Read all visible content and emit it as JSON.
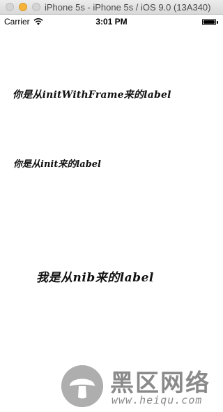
{
  "window": {
    "title": "iPhone 5s - iPhone 5s / iOS 9.0 (13A340)"
  },
  "statusbar": {
    "carrier": "Carrier",
    "time": "3:01 PM",
    "icons": [
      "wifi-icon",
      "battery-icon"
    ]
  },
  "labels": {
    "init_with_frame": "你是从initWithFrame来的label",
    "init": "你是从init来的label",
    "nib": "我是从nib来的label"
  },
  "watermark": {
    "brand_cn": "黑区网络",
    "url": "www.heiqu.com"
  },
  "colors": {
    "titlebar": "#dcdcdc",
    "minimize": "#f5b33a",
    "background": "#ffffff",
    "watermark": "#8a8a8a"
  }
}
